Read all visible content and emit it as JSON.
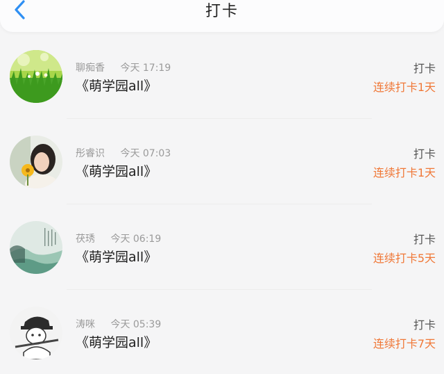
{
  "header": {
    "title": "打卡"
  },
  "colors": {
    "accent_blue": "#2f8ff3",
    "streak_orange": "#f07736"
  },
  "icons": {
    "back": "chevron-left-icon"
  },
  "checkins": [
    {
      "name": "聊痴香",
      "time": "今天 17:19",
      "content": "《萌学园all》",
      "action": "打卡",
      "streak": "连续打卡1天"
    },
    {
      "name": "彤睿识",
      "time": "今天 07:03",
      "content": "《萌学园all》",
      "action": "打卡",
      "streak": "连续打卡1天"
    },
    {
      "name": "茯琇",
      "time": "今天 06:19",
      "content": "《萌学园all》",
      "action": "打卡",
      "streak": "连续打卡5天"
    },
    {
      "name": "涛咪",
      "time": "今天 05:39",
      "content": "《萌学园all》",
      "action": "打卡",
      "streak": "连续打卡7天"
    }
  ]
}
